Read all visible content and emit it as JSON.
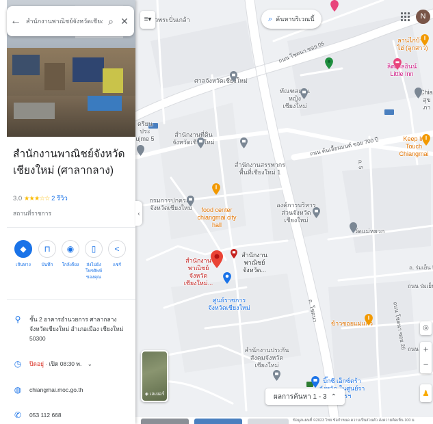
{
  "search": {
    "value": "สำนักงานพาณิชย์จังหวัดเชียงใหม่",
    "back_icon": "arrow-left-icon",
    "search_icon": "search-icon",
    "close_icon": "close-icon"
  },
  "place": {
    "title": "สำนักงานพาณิชย์จังหวัดเชียงใหม่ (ศาลากลาง)",
    "rating": "3.0",
    "stars": "★★★☆☆",
    "review_count": "2 รีวิว",
    "category": "สถานที่ราชการ"
  },
  "actions": [
    {
      "label": "เส้นทาง",
      "icon": "directions-icon"
    },
    {
      "label": "บันทึก",
      "icon": "bookmark-icon"
    },
    {
      "label": "ใกล้เคียง",
      "icon": "nearby-icon"
    },
    {
      "label": "ส่งไปยังโทรศัพท์ของคุณ",
      "icon": "send-to-phone-icon"
    },
    {
      "label": "แชร์",
      "icon": "share-icon"
    }
  ],
  "info": {
    "address": "ชั้น 2 อาคารอำนวยการ ศาลากลางจังหวัดเชียงใหม่ อำเภอเมือง เชียงใหม่ 50300",
    "hours_status": "ปิดอยู่",
    "hours_rest": " · เปิด 08:30 พ.",
    "website": "chiangmai.moc.go.th",
    "phone": "053 112 668"
  },
  "map_controls": {
    "nearby_search": "ค้นหาบริเวณนี้",
    "layers_label": "เลเยอร์",
    "results": "ผลการค้นหา 1 - 3",
    "avatar_initial": "N",
    "footer": "ข้อมูลแผนที่ ©2023  ไทย  ข้อกำหนด  ความเป็นส่วนตัว  ส่งความคิดเห็น  100 ม."
  },
  "map_labels": {
    "top_road": "เวพระปั่นเกล้า",
    "sala": "ศาลจังหวัดเชียงใหม่",
    "land_office": "สำนักงานที่ดินจังหวัดเชียงใหม่",
    "revenue": "สำนักงานสรรพากรพื้นที่เชียงใหม่ 1",
    "land_admin": "กรมการปกครองจังหวัดเชียงใหม่",
    "food_center": "food center chiangmai city hall",
    "pao": "องค์การบริหารส่วนจังหวัดเชียงใหม่",
    "commerce_red": "สำนักงานพาณิชย์จังหวัดเชียงใหม่...",
    "commerce_small": "สำนักงานพาณิชย์จังหวัด...",
    "gov_center": "ศูนย์ราชการจังหวัดเชียงใหม่",
    "social_security": "สำนักงานประกันสังคมจังหวัดเชียงใหม่",
    "court_office": "ทัณฑสถานหญิงเชียงใหม่",
    "wat": "วัดแม่หยวก",
    "khao_soi": "ข้าวซอยแม่แก้ว",
    "tesco": "บิ๊กซี เอ็กซ์ตร้า จังหวัด ในศูนย์ราชการฯ",
    "little_inn": "ลิตเติ้ลอินน์ Little Inn",
    "restaurant": "ลานไก่บ้านไฮ่ (ลูกสาว)",
    "keep_in_touch": "Keep In Touch Chiangmai",
    "chiang": "Chian สุขภา",
    "road_5": "ซอย 5",
    "road_700": "ถนน ต้นเอื้อมมนต์ ซอย 700 ปี",
    "road_soi": "ถ. ร่มเย็น 5",
    "road_soi2": "ถนน ร่มเย็น 6",
    "khuang": "ถ. โชตนา",
    "road_26": "ถนน โชตนา ซอย 26",
    "road_ob": "ถนน โชตนา ซอย 05",
    "road_north": "ถนน โชค",
    "e_school": "ดรียนประ ujme 5",
    "route_11": "ถ. 5",
    "route_bottom": "ถ. โชตนา"
  }
}
